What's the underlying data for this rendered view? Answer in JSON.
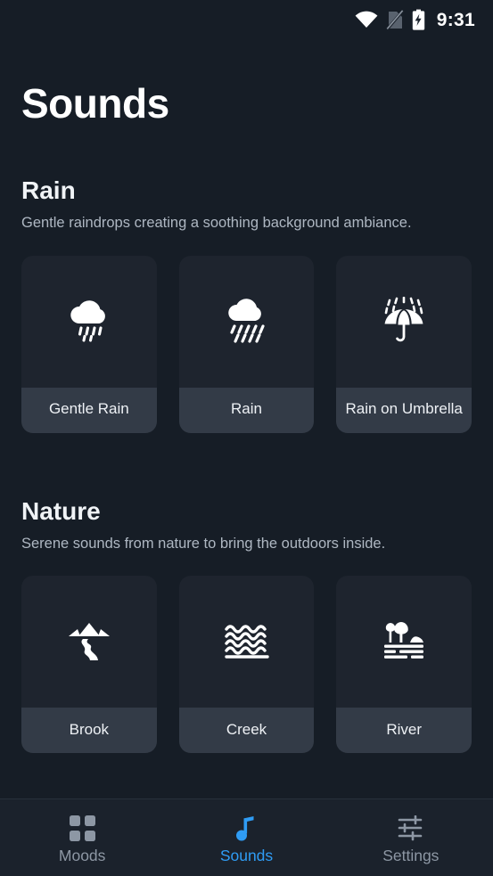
{
  "status_bar": {
    "time": "9:31",
    "icons": [
      "wifi-icon",
      "no-sim-icon",
      "battery-charging-icon"
    ]
  },
  "header": {
    "title": "Sounds"
  },
  "colors": {
    "page_background": "#161d26",
    "card_background": "#1e242e",
    "card_label_background": "#333b47",
    "accent": "#2f9cf4",
    "muted_text": "#8d97a4",
    "body_text": "#aeb7c2"
  },
  "sections": [
    {
      "title": "Rain",
      "description": "Gentle raindrops creating a soothing background ambiance.",
      "cards": [
        {
          "label": "Gentle Rain",
          "icon": "cloud-drizzle-icon"
        },
        {
          "label": "Rain",
          "icon": "cloud-rain-icon"
        },
        {
          "label": "Rain on Umbrella",
          "icon": "umbrella-rain-icon"
        }
      ]
    },
    {
      "title": "Nature",
      "description": "Serene sounds from nature to bring the outdoors inside.",
      "cards": [
        {
          "label": "Brook",
          "icon": "mountain-stream-icon"
        },
        {
          "label": "Creek",
          "icon": "water-waves-icon"
        },
        {
          "label": "River",
          "icon": "river-landscape-icon"
        }
      ]
    }
  ],
  "bottom_nav": {
    "items": [
      {
        "label": "Moods",
        "icon": "grid-icon",
        "active": false
      },
      {
        "label": "Sounds",
        "icon": "music-note-icon",
        "active": true
      },
      {
        "label": "Settings",
        "icon": "sliders-icon",
        "active": false
      }
    ]
  }
}
